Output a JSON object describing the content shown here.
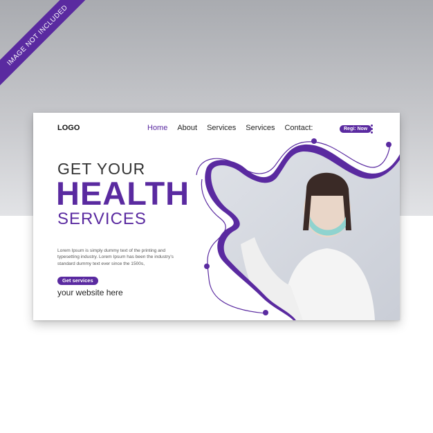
{
  "ribbon": {
    "text": "IMAGE NOT INCLUDED"
  },
  "header": {
    "logo": "LOGO",
    "nav": [
      {
        "label": "Home",
        "active": true
      },
      {
        "label": "About",
        "active": false
      },
      {
        "label": "Services",
        "active": false
      },
      {
        "label": "Services",
        "active": false
      },
      {
        "label": "Contact:",
        "active": false
      }
    ],
    "register_label": "Regi: Now",
    "menu_icon": "more-vertical-icon"
  },
  "hero": {
    "line1": "GET YOUR",
    "line2": "HEALTH",
    "line3": "SERVICES",
    "body": "Lorem Ipsum is simply dummy text of the printing and typesetting industry. Lorem Ipsum has been the industry's standard dummy text ever since the 1500s,",
    "cta_label": "Get services",
    "website": "your website here"
  },
  "colors": {
    "accent": "#5a2aa0",
    "backdrop": "#b9bbbf"
  }
}
